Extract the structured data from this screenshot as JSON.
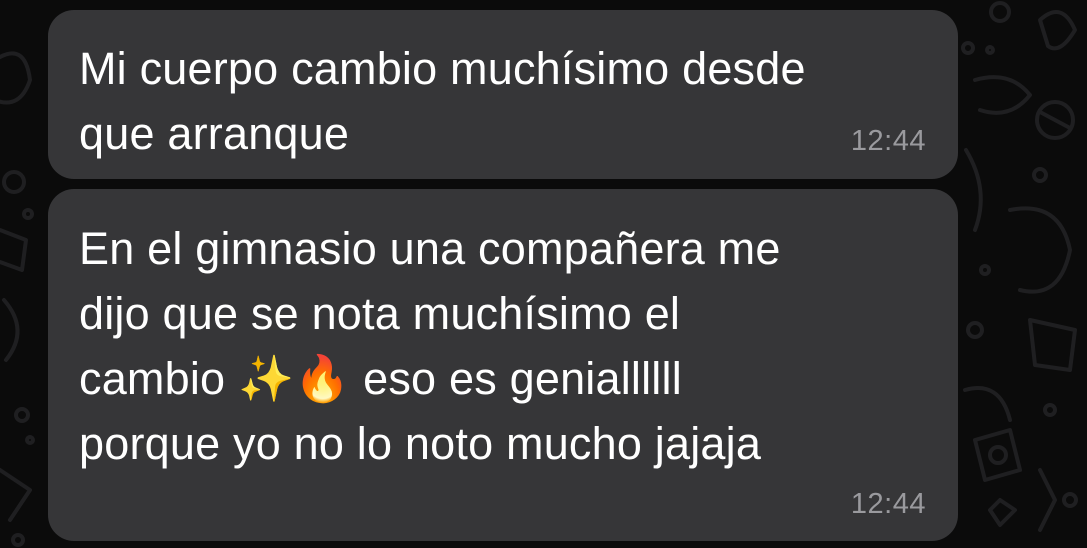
{
  "chat": {
    "messages": [
      {
        "text": "Mi cuerpo cambio muchísimo desde\nque arranque",
        "time": "12:44"
      },
      {
        "text": "En el gimnasio una compañera me\ndijo que se nota muchísimo el\ncambio ✨🔥 eso es geniallllll\nporque yo no lo noto mucho jajaja",
        "time": "12:44"
      }
    ]
  },
  "colors": {
    "background": "#0b0b0b",
    "bubble": "#363638",
    "text": "#ffffff",
    "timestamp": "#9a9a9e",
    "doodle": "#1f1f21"
  }
}
